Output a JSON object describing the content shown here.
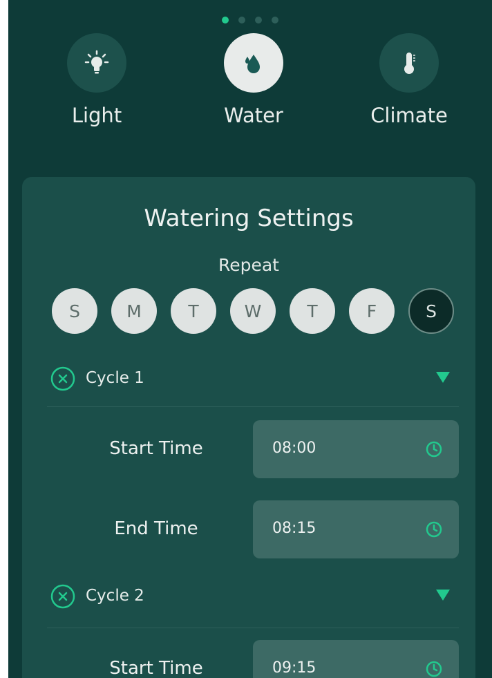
{
  "modes": [
    {
      "label": "Light",
      "icon": "lightbulb-icon"
    },
    {
      "label": "Water",
      "icon": "water-drop-icon"
    },
    {
      "label": "Climate",
      "icon": "thermometer-icon"
    }
  ],
  "pager": {
    "count": 4,
    "active_index": 0
  },
  "panel": {
    "title": "Watering Settings",
    "repeat_label": "Repeat",
    "days": [
      {
        "label": "S",
        "selected": true
      },
      {
        "label": "M",
        "selected": true
      },
      {
        "label": "T",
        "selected": true
      },
      {
        "label": "W",
        "selected": true
      },
      {
        "label": "T",
        "selected": true
      },
      {
        "label": "F",
        "selected": true
      },
      {
        "label": "S",
        "selected": false
      }
    ],
    "cycles": [
      {
        "name": "Cycle 1",
        "start_label": "Start Time",
        "start": "08:00",
        "end_label": "End Time",
        "end": "08:15"
      },
      {
        "name": "Cycle 2",
        "start_label": "Start Time",
        "start": "09:15"
      }
    ]
  },
  "colors": {
    "accent": "#22c98e",
    "background": "#0e3b38",
    "panel": "#1b4f4a",
    "field": "#3d6a65"
  }
}
